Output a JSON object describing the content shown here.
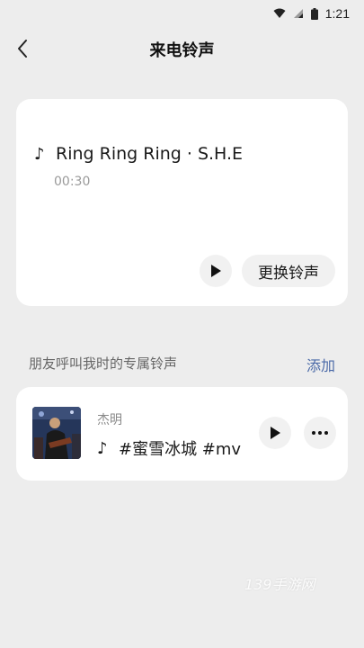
{
  "status_bar": {
    "time": "1:21"
  },
  "header": {
    "title": "来电铃声"
  },
  "current_ringtone": {
    "song": "Ring Ring Ring · S.H.E",
    "duration": "00:30",
    "change_label": "更换铃声"
  },
  "friends_section": {
    "title": "朋友呼叫我时的专属铃声",
    "add_label": "添加",
    "items": [
      {
        "contact": "杰明",
        "ringtone": "#蜜雪冰城 #mv"
      }
    ]
  },
  "watermark": "139手游网",
  "colors": {
    "background": "#ededed",
    "card": "#ffffff",
    "link": "#4b6aa8"
  }
}
